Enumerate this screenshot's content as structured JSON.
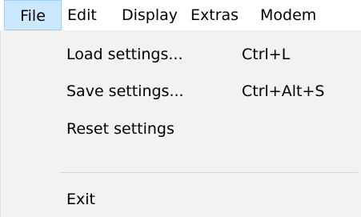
{
  "menubar": {
    "items": [
      {
        "label": "File"
      },
      {
        "label": "Edit"
      },
      {
        "label": "Display"
      },
      {
        "label": "Extras"
      },
      {
        "label": "Modem"
      }
    ],
    "active_index": 0
  },
  "file_menu": {
    "items": [
      {
        "label": "Load settings...",
        "shortcut": "Ctrl+L"
      },
      {
        "label": "Save settings...",
        "shortcut": "Ctrl+Alt+S"
      },
      {
        "label": "Reset settings",
        "shortcut": ""
      },
      {
        "label": "Exit",
        "shortcut": ""
      }
    ]
  },
  "colors": {
    "menubar_background": "#ffffff",
    "active_highlight": "#cce8ff",
    "active_border": "#99d1ff",
    "dropdown_background": "#f2f2f2",
    "separator": "#d4d4d4"
  }
}
